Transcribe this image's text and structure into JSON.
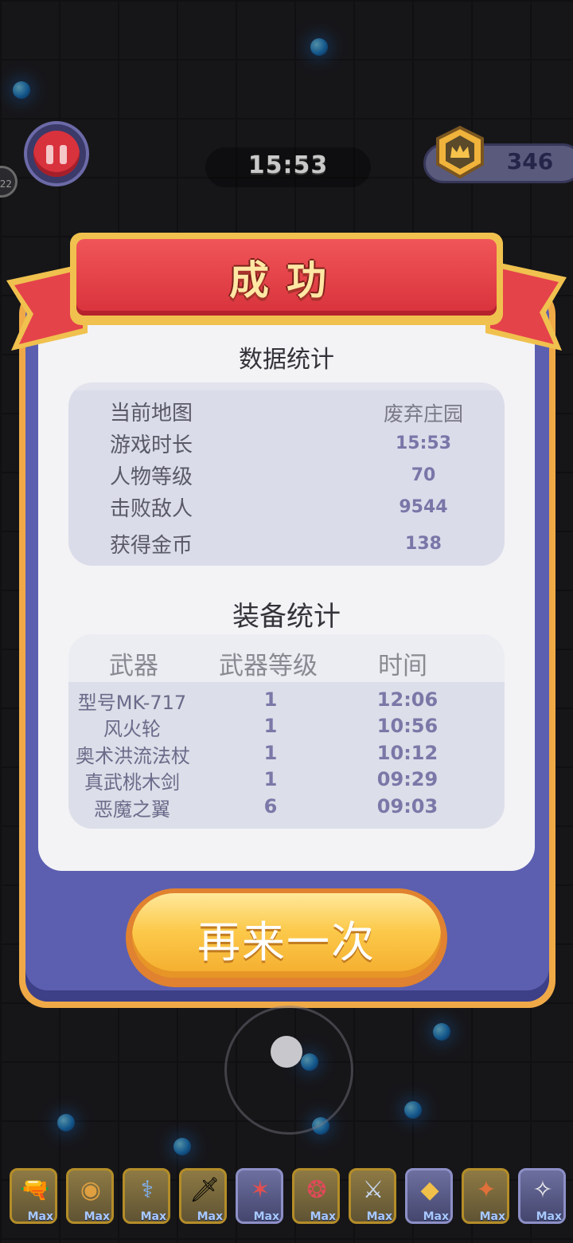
{
  "hud": {
    "timer": "15:53",
    "coins": "346",
    "side_badge": "22"
  },
  "dialog": {
    "title": "成功",
    "stats_title": "数据统计",
    "stats": [
      {
        "label": "当前地图",
        "value": "废弃庄园"
      },
      {
        "label": "游戏时长",
        "value": "15:53"
      },
      {
        "label": "人物等级",
        "value": "70"
      },
      {
        "label": "击败敌人",
        "value": "9544"
      },
      {
        "label": "获得金币",
        "value": "138"
      }
    ],
    "equip_title": "装备统计",
    "equip_headers": [
      "武器",
      "武器等级",
      "时间"
    ],
    "equipment": [
      {
        "name": "型号MK-717",
        "level": "1",
        "time": "12:06"
      },
      {
        "name": "风火轮",
        "level": "1",
        "time": "10:56"
      },
      {
        "name": "奥术洪流法杖",
        "level": "1",
        "time": "10:12"
      },
      {
        "name": "真武桃木剑",
        "level": "1",
        "time": "09:29"
      },
      {
        "name": "恶魔之翼",
        "level": "6",
        "time": "09:03"
      }
    ],
    "retry_label": "再来一次"
  },
  "skills": [
    {
      "icon": "cannon-icon",
      "glyph": "🔫",
      "label": "Max"
    },
    {
      "icon": "wheel-icon",
      "glyph": "◉",
      "label": "Max"
    },
    {
      "icon": "staff-icon",
      "glyph": "⚕",
      "label": "Max"
    },
    {
      "icon": "sword-icon",
      "glyph": "🗡",
      "label": "Max"
    },
    {
      "icon": "claw-icon",
      "glyph": "✶",
      "label": "Max"
    },
    {
      "icon": "rune-icon",
      "glyph": "❂",
      "label": "Max"
    },
    {
      "icon": "blade-icon",
      "glyph": "⚔",
      "label": "Max"
    },
    {
      "icon": "crystal-icon",
      "glyph": "◆",
      "label": "Max"
    },
    {
      "icon": "torch-icon",
      "glyph": "✦",
      "label": "Max"
    },
    {
      "icon": "wings-icon",
      "glyph": "✧",
      "label": "Max"
    }
  ],
  "colors": {
    "accent_red": "#d8323c",
    "panel_blue": "#5c5fb0",
    "button_gold": "#fcc94a",
    "value_purple": "#7a76a8"
  }
}
